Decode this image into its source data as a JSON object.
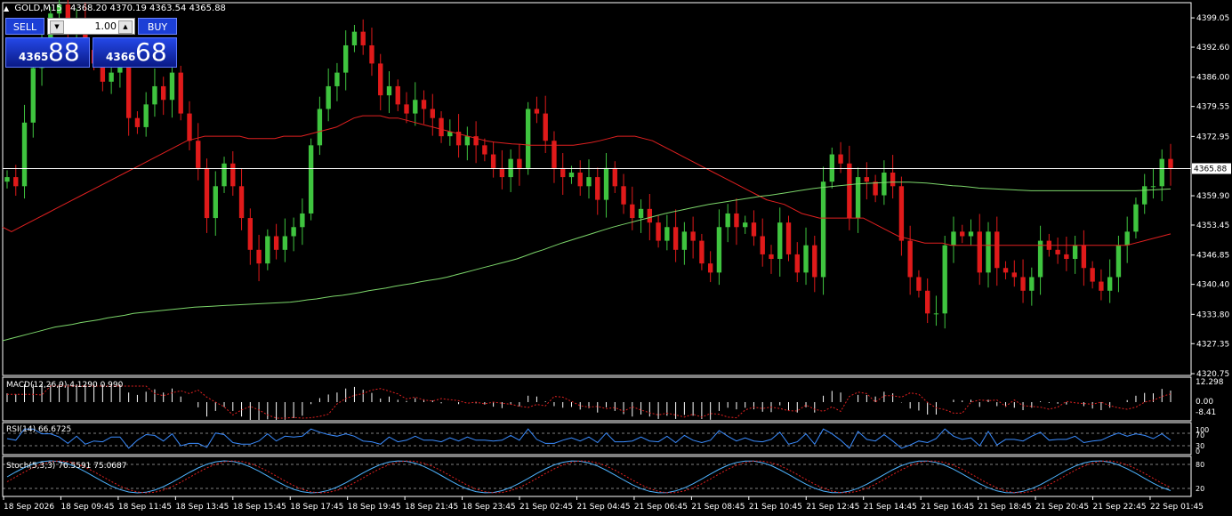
{
  "header": {
    "symbol_tf": "GOLD,M15",
    "ohlc": "4368.20 4370.19 4363.54 4365.88"
  },
  "trade_panel": {
    "sell_label": "SELL",
    "buy_label": "BUY",
    "lot": "1.00",
    "sell_small": "4365",
    "sell_big": "88",
    "buy_small": "4366",
    "buy_big": "68"
  },
  "price_axis": {
    "labels": [
      "4399.05",
      "4392.60",
      "4386.00",
      "4379.55",
      "4372.95",
      "4359.90",
      "4353.45",
      "4346.85",
      "4340.40",
      "4333.80",
      "4327.35",
      "4320.75"
    ],
    "current": "4365.88"
  },
  "indicators": {
    "macd": {
      "label": "MACD(12,26,9) 4.1290 0.990",
      "levels": [
        "12.298",
        "0.00",
        "-8.41"
      ]
    },
    "rsi": {
      "label": "RSI(14) 66.6725",
      "levels": [
        "100",
        "70",
        "30",
        "0"
      ]
    },
    "stoch": {
      "label": "Stoch(5,3,3) 76.5591 75.0687",
      "levels": [
        "80",
        "20"
      ]
    }
  },
  "time_axis": [
    "18 Sep 2026",
    "18 Sep 09:45",
    "18 Sep 11:45",
    "18 Sep 13:45",
    "18 Sep 15:45",
    "18 Sep 17:45",
    "18 Sep 19:45",
    "18 Sep 21:45",
    "18 Sep 23:45",
    "21 Sep 02:45",
    "21 Sep 04:45",
    "21 Sep 06:45",
    "21 Sep 08:45",
    "21 Sep 10:45",
    "21 Sep 12:45",
    "21 Sep 14:45",
    "21 Sep 16:45",
    "21 Sep 18:45",
    "21 Sep 20:45",
    "21 Sep 22:45",
    "22 Sep 01:45"
  ],
  "colors": {
    "bull": "#3fc43f",
    "bear": "#e01a1a",
    "ma_fast": "#e02020",
    "ma_slow": "#7cd66a",
    "macd_signal": "#e02020",
    "osc": "#3a8cff",
    "stoch_signal": "#e02020",
    "grid": "#ffffff"
  },
  "chart_data": {
    "type": "candlestick",
    "symbol": "GOLD",
    "timeframe": "M15",
    "ylim": [
      4320.75,
      4402.0
    ],
    "closes": [
      4364,
      4362,
      4376,
      4388,
      4394,
      4400,
      4402,
      4396,
      4399,
      4392,
      4389,
      4385,
      4387,
      4389,
      4377,
      4375,
      4380,
      4384,
      4381,
      4387,
      4378,
      4372,
      4366,
      4355,
      4362,
      4367,
      4362,
      4355,
      4348,
      4345,
      4351,
      4348,
      4351,
      4353,
      4356,
      4371,
      4379,
      4384,
      4387,
      4393,
      4396,
      4393,
      4389,
      4382,
      4384,
      4380,
      4378,
      4381,
      4379,
      4377,
      4373,
      4374,
      4371,
      4373,
      4371,
      4369,
      4366,
      4364,
      4368,
      4366,
      4379,
      4378,
      4372,
      4366,
      4364,
      4365,
      4362,
      4364,
      4359,
      4366,
      4362,
      4358,
      4355,
      4357,
      4354,
      4350,
      4353,
      4348,
      4352,
      4350,
      4345,
      4343,
      4353,
      4356,
      4353,
      4354,
      4351,
      4347,
      4346,
      4354,
      4347,
      4343,
      4349,
      4342,
      4363,
      4369,
      4367,
      4355,
      4364,
      4363,
      4360,
      4365,
      4362,
      4350,
      4342,
      4339,
      4334,
      4334,
      4349,
      4352,
      4351,
      4352,
      4343,
      4352,
      4344,
      4343,
      4342,
      4339,
      4342,
      4350,
      4348,
      4347,
      4346,
      4349,
      4344,
      4341,
      4339,
      4342,
      4349,
      4352,
      4358,
      4362,
      4362,
      4368,
      4366
    ],
    "ma_fast": [
      4353,
      4352,
      4353,
      4354,
      4355,
      4356,
      4357,
      4358,
      4359,
      4360,
      4361,
      4362,
      4363,
      4364,
      4365,
      4366,
      4367,
      4368,
      4369,
      4370,
      4371,
      4372,
      4372.5,
      4373,
      4373,
      4373,
      4373,
      4373,
      4372.5,
      4372.5,
      4372.5,
      4372.5,
      4373,
      4373,
      4373,
      4373.5,
      4374,
      4374.5,
      4375,
      4376,
      4377,
      4377.5,
      4377.5,
      4377.5,
      4377,
      4377,
      4376.5,
      4376,
      4375.5,
      4375,
      4374.5,
      4374,
      4373.5,
      4373,
      4372.5,
      4372,
      4371.7,
      4371.5,
      4371.3,
      4371.2,
      4371,
      4371,
      4371,
      4371,
      4371,
      4371,
      4371.3,
      4371.6,
      4372,
      4372.5,
      4373,
      4373,
      4373,
      4372.5,
      4372,
      4371,
      4370,
      4369,
      4368,
      4367,
      4366,
      4365,
      4364,
      4363,
      4362,
      4361,
      4360,
      4359,
      4358.5,
      4358,
      4357,
      4356,
      4355.5,
      4355,
      4355,
      4355,
      4355,
      4355,
      4355,
      4354,
      4353,
      4352,
      4351,
      4350.5,
      4350,
      4349.5,
      4349.5,
      4349.5,
      4349,
      4349,
      4349,
      4349,
      4349,
      4349,
      4349,
      4349,
      4349,
      4349,
      4349,
      4349,
      4349,
      4349,
      4349,
      4349,
      4349,
      4349,
      4349,
      4349,
      4349,
      4349.5,
      4350,
      4350.5,
      4351,
      4351.5
    ],
    "ma_slow": [
      4328,
      4328.5,
      4329,
      4329.5,
      4330,
      4330.5,
      4331,
      4331.3,
      4331.6,
      4332,
      4332.3,
      4332.6,
      4333,
      4333.3,
      4333.6,
      4334,
      4334.2,
      4334.4,
      4334.6,
      4334.8,
      4335,
      4335.2,
      4335.4,
      4335.5,
      4335.6,
      4335.7,
      4335.8,
      4335.9,
      4336,
      4336.1,
      4336.2,
      4336.3,
      4336.4,
      4336.5,
      4336.7,
      4337,
      4337.2,
      4337.5,
      4337.8,
      4338,
      4338.3,
      4338.6,
      4339,
      4339.3,
      4339.6,
      4340,
      4340.3,
      4340.6,
      4341,
      4341.3,
      4341.6,
      4342,
      4342.5,
      4343,
      4343.5,
      4344,
      4344.5,
      4345,
      4345.5,
      4346,
      4346.7,
      4347.4,
      4348,
      4348.7,
      4349.4,
      4350,
      4350.6,
      4351.2,
      4351.8,
      4352.4,
      4353,
      4353.5,
      4354,
      4354.5,
      4355,
      4355.5,
      4356,
      4356.4,
      4356.8,
      4357.2,
      4357.6,
      4358,
      4358.3,
      4358.6,
      4358.9,
      4359.2,
      4359.5,
      4359.8,
      4360,
      4360.3,
      4360.6,
      4360.9,
      4361.2,
      4361.5,
      4361.7,
      4361.9,
      4362.1,
      4362.3,
      4362.5,
      4362.6,
      4362.7,
      4362.8,
      4362.9,
      4362.9,
      4362.9,
      4362.8,
      4362.7,
      4362.5,
      4362.3,
      4362.1,
      4362,
      4361.8,
      4361.6,
      4361.5,
      4361.4,
      4361.3,
      4361.2,
      4361.1,
      4361,
      4361,
      4361,
      4361,
      4361,
      4361,
      4361,
      4361,
      4361,
      4361,
      4361,
      4361,
      4361,
      4361.1,
      4361.2,
      4361.3,
      4361.4
    ]
  }
}
